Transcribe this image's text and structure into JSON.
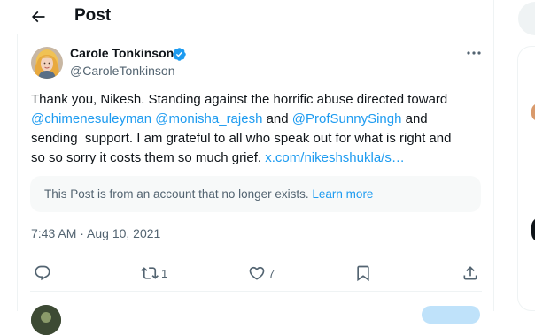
{
  "header": {
    "back_icon": "arrow-left-icon",
    "title": "Post"
  },
  "tweet": {
    "author": {
      "name": "Carole Tonkinson",
      "handle": "@CaroleTonkinson",
      "verified_icon": "verified-badge-icon"
    },
    "more_icon": "more-horizontal-icon",
    "text": {
      "line1": "Thank you, Nikesh. Standing against the horrific abuse directed toward",
      "mention1": "@chimenesuleyman",
      "mention2": "@monisha_rajesh",
      "and1": " and ",
      "mention3": "@ProfSunnySingh",
      "and2": " and",
      "line3": "sending  support. I am grateful to all who speak out for what is right and",
      "line4": "so so sorry it costs them so much grief. ",
      "link": "x.com/nikeshshukla/s…"
    },
    "unavailable_notice": {
      "text": "This Post is from an account that no longer exists. ",
      "link": "Learn more"
    },
    "timestamp": "7:43 AM · Aug 10, 2021",
    "actions": {
      "reply": {
        "icon": "reply-icon",
        "count": ""
      },
      "repost": {
        "icon": "repost-icon",
        "count": "1"
      },
      "like": {
        "icon": "heart-icon",
        "count": "7"
      },
      "bookmark": {
        "icon": "bookmark-icon",
        "count": ""
      },
      "share": {
        "icon": "share-icon",
        "count": ""
      }
    }
  },
  "colors": {
    "accent": "#1d9bf0",
    "text_primary": "#0f1419",
    "text_secondary": "#536471",
    "border": "#eff3f4",
    "notice_bg": "#f7f9f9"
  }
}
